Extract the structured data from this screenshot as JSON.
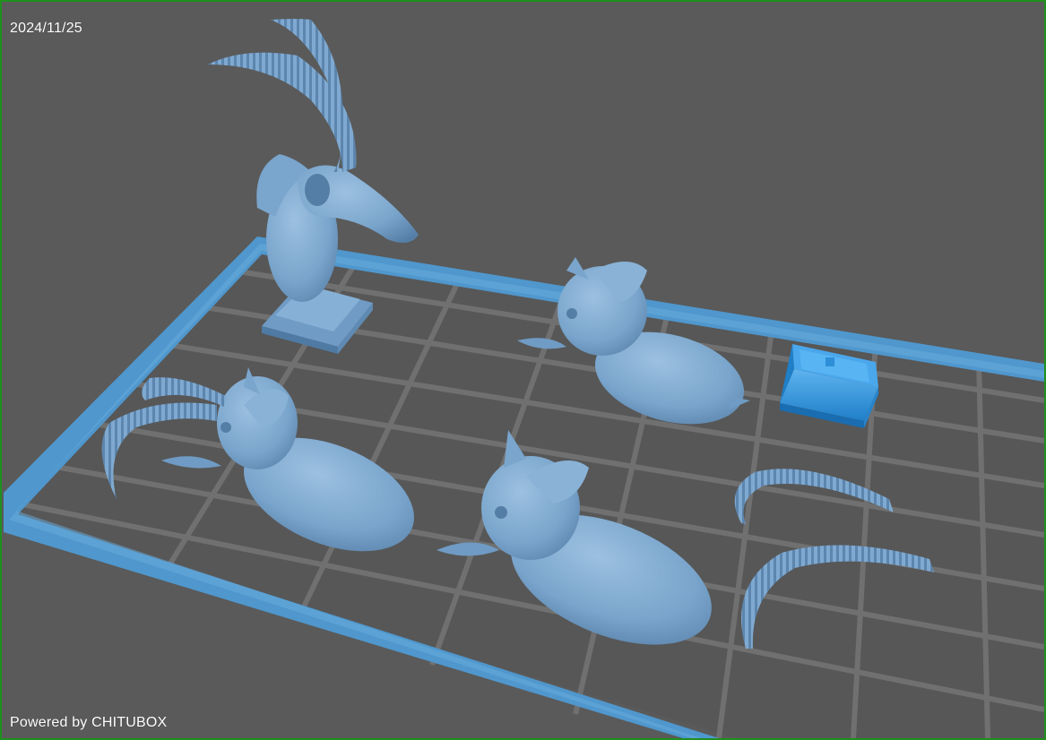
{
  "app": {
    "date": "2024/11/25",
    "powered_by": "Powered by CHITUBOX"
  },
  "colors": {
    "background": "#5a5a5a",
    "grid_line": "#6e6e6e",
    "plate_border": "#4f97cd",
    "model": "#7ba7cf",
    "model_dark": "#4f7aa3",
    "model_selected": "#2d8fd8",
    "frame_border": "#1f8f1f"
  },
  "scene": {
    "models": [
      {
        "name": "mounted-antelope-bust-with-horns",
        "selected": false
      },
      {
        "name": "antelope-head-part-top-right",
        "selected": false
      },
      {
        "name": "antelope-head-part-with-horns",
        "selected": false
      },
      {
        "name": "antelope-head-part-center",
        "selected": false
      },
      {
        "name": "horn-part-upper",
        "selected": false
      },
      {
        "name": "horn-part-lower",
        "selected": false
      },
      {
        "name": "plaque-base-part",
        "selected": true
      }
    ]
  }
}
